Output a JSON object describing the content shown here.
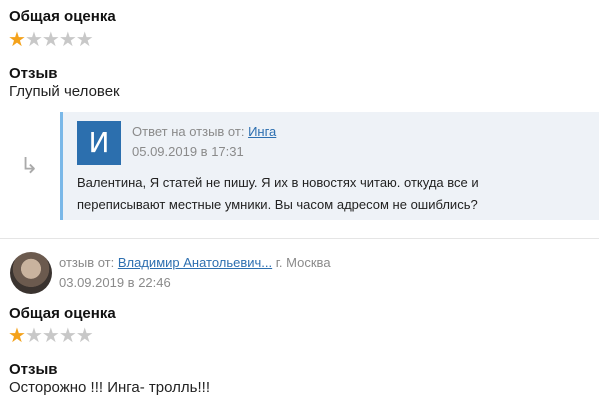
{
  "review1": {
    "rating_heading": "Общая оценка",
    "rating": 1,
    "rating_max": 5,
    "review_heading": "Отзыв",
    "review_text": "Глупый человек"
  },
  "reply": {
    "avatar_letter": "И",
    "prefix": "Ответ на отзыв от:",
    "author": "Инга",
    "datetime": "05.09.2019 в 17:31",
    "text_line1": "Валентина, Я статей не пишу. Я их в новостях читаю. откуда все и",
    "text_line2": "переписывают местные умники. Вы часом адресом не ошиблись?",
    "arrow_glyph": "↳"
  },
  "review2": {
    "prefix": "отзыв от:",
    "author": "Владимир Анатольевич...",
    "city": "г. Москва",
    "datetime": "03.09.2019 в 22:46",
    "rating_heading": "Общая оценка",
    "rating": 1,
    "rating_max": 5,
    "review_heading": "Отзыв",
    "review_text": "Осторожно !!! Инга- тролль!!!"
  },
  "colors": {
    "star_on": "#f4a21b",
    "star_off": "#c8c8c8",
    "link": "#2d6fb0",
    "reply_bg": "#eef2f7",
    "reply_border": "#7ab8e8",
    "avatar_bg": "#2c6fae"
  }
}
